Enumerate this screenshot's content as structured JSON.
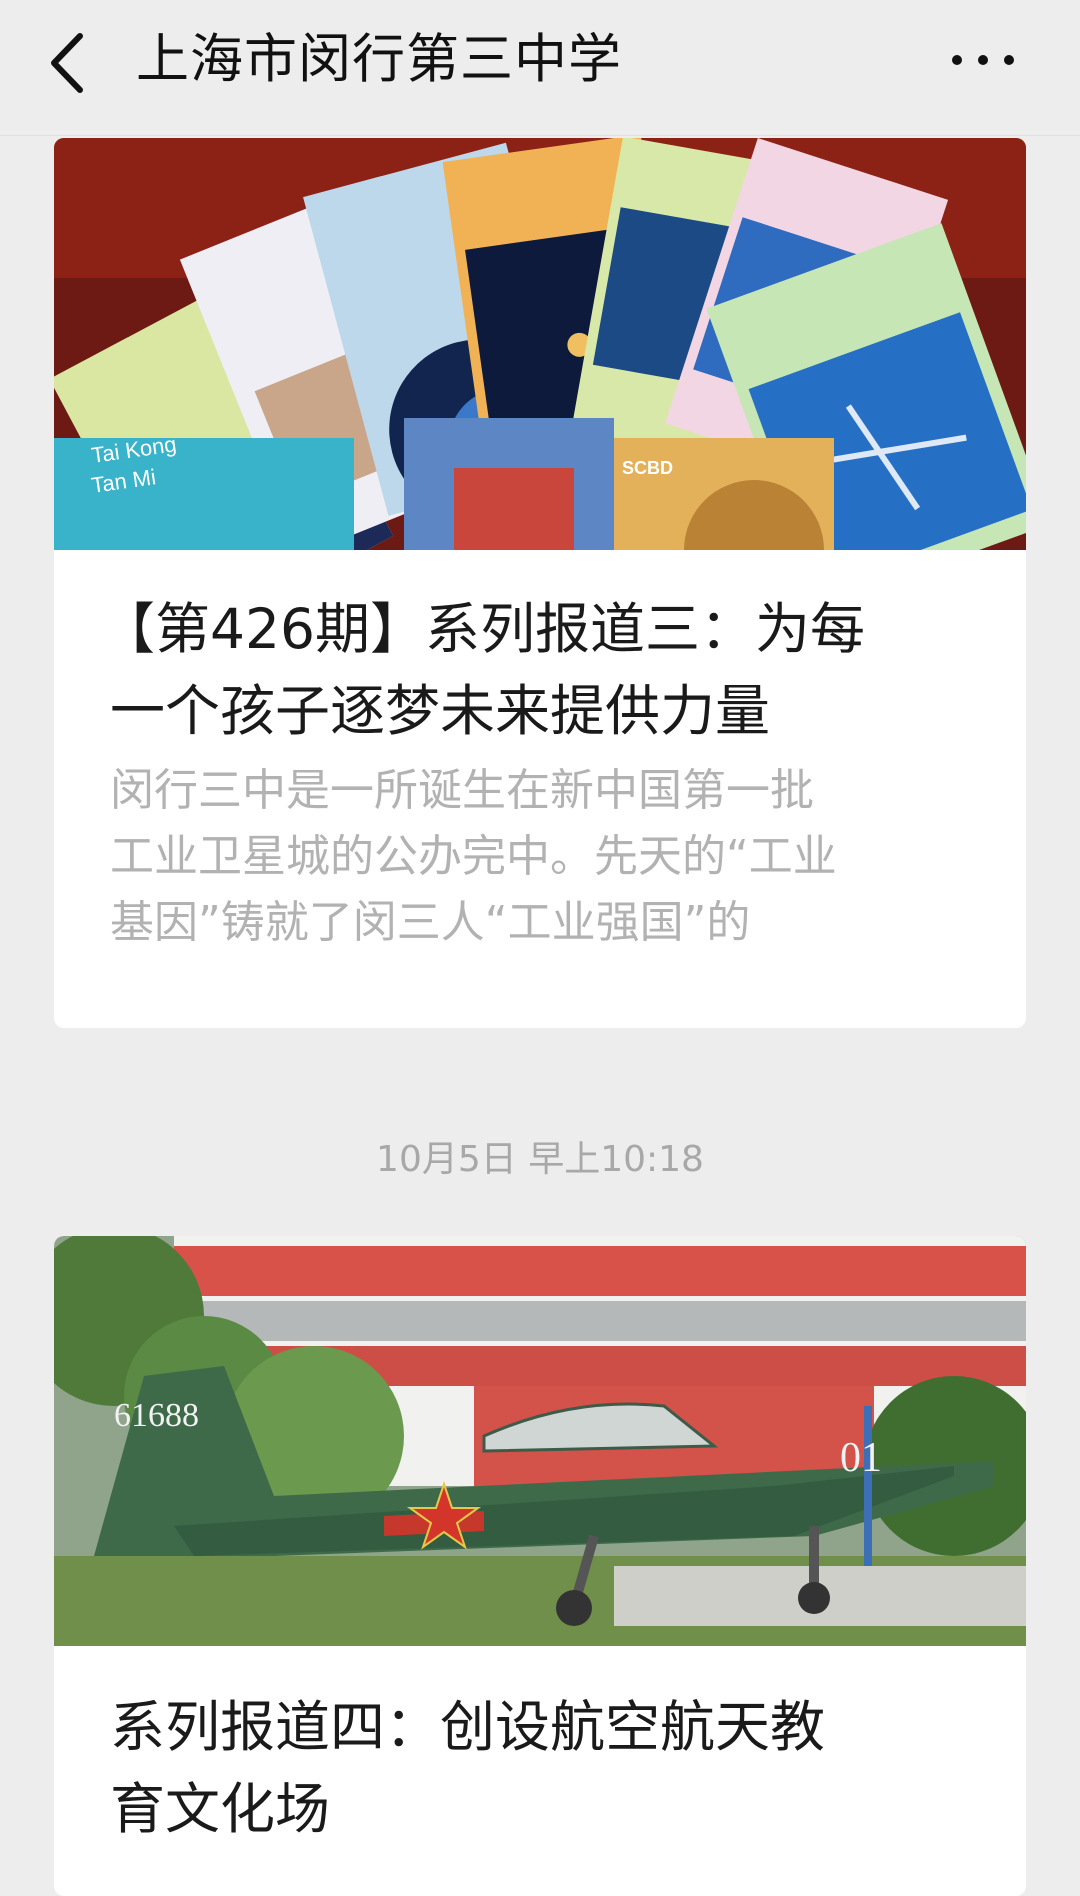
{
  "header": {
    "back_icon": "chevron-left-icon",
    "title": "上海市闵行第三中学",
    "more_icon": "more-dots-icon"
  },
  "articles": [
    {
      "title_line1": "【第426期】系列报道三：为每",
      "title_line2": "一个孩子逐梦未来提供力量",
      "desc_line1": "闵行三中是一所诞生在新中国第一批",
      "desc_line2": "工业卫星城的公办完中。先天的“工业",
      "desc_line3": "基因”铸就了闵三人“工业强国”的",
      "cover_text": {
        "tai_kong": "Tai Kong",
        "tan_mi": "Tan Mi",
        "scbd": "SCBD"
      }
    },
    {
      "time": "10月5日 早上10:18",
      "title_line1": "系列报道四：创设航空航天教",
      "title_line2": "育文化场",
      "cover_text": {
        "tail_number": "61688",
        "nose_number": "01"
      }
    }
  ]
}
